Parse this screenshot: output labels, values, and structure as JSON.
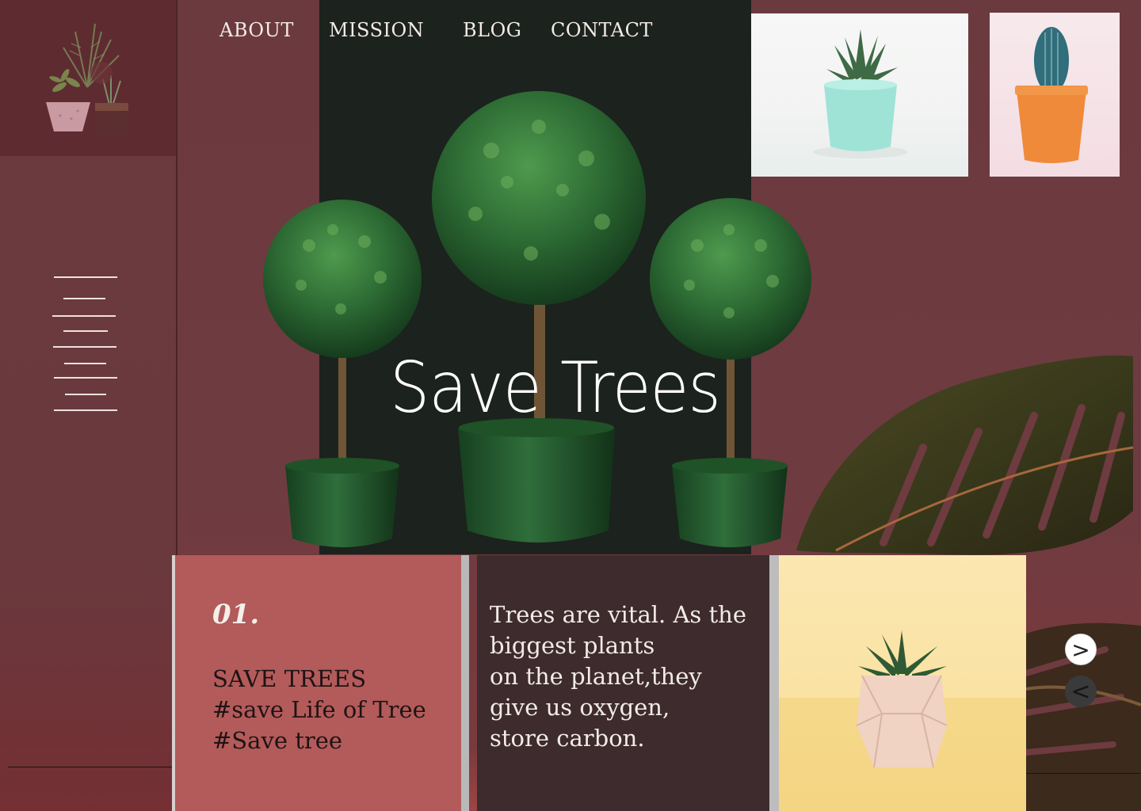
{
  "nav": {
    "items": [
      {
        "label": "ABOUT"
      },
      {
        "label": "MISSION"
      },
      {
        "label": "BLOG"
      },
      {
        "label": "CONTACT"
      }
    ]
  },
  "hero": {
    "title": "Save Trees"
  },
  "card1": {
    "number": "01.",
    "lines": [
      "SAVE TREES",
      "#save Life of Tree",
      "#Save tree"
    ]
  },
  "card2": {
    "text": "Trees are vital. As the\nbiggest plants\n on the planet,they\ngive us oxygen,\n store carbon."
  },
  "carousel": {
    "next_label": ">",
    "prev_label": "<"
  },
  "icons": {
    "logo": "potted-plants-logo-icon",
    "menu": "hamburger-menu-icon"
  },
  "colors": {
    "background": "#6b3a3e",
    "card_rose": "#b35b5a",
    "card_dark": "#3d2b2d",
    "card_yellow": "#f9e2a3",
    "hero_dark": "#1c221d",
    "leaf_green": "#2f6a3a"
  }
}
